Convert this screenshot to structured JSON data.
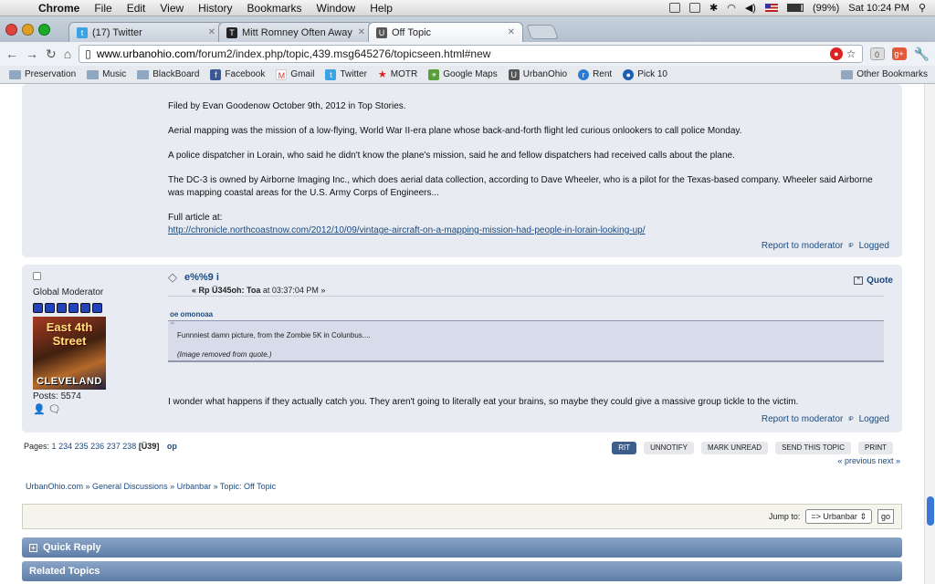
{
  "menubar": {
    "app": "Chrome",
    "items": [
      "File",
      "Edit",
      "View",
      "History",
      "Bookmarks",
      "Window",
      "Help"
    ],
    "battery": "(99%)",
    "clock": "Sat 10:24 PM"
  },
  "tabs": [
    {
      "title": "(17) Twitter",
      "active": false
    },
    {
      "title": "Mitt Romney Often Away Wh",
      "active": false
    },
    {
      "title": "Off Topic",
      "active": true
    }
  ],
  "toolbar": {
    "url_host": "www.urbanohio.com",
    "url_path": "/forum2/index.php/topic,439.msg645276/topicseen.html#new",
    "badge_count": "0"
  },
  "bookmarks": [
    "Preservation",
    "Music",
    "BlackBoard",
    "Facebook",
    "Gmail",
    "Twitter",
    "MOTR",
    "Google Maps",
    "UrbanOhio",
    "Rent",
    "Pick 10"
  ],
  "bookmarks_other": "Other Bookmarks",
  "post1": {
    "paragraphs": [
      "Filed by Evan Goodenow October 9th, 2012 in Top Stories.",
      "Aerial mapping was the mission of a low-flying, World War II-era plane whose back-and-forth flight led curious onlookers to call police Monday.",
      "A police dispatcher in Lorain, who said he didn't know the plane's mission, said he and fellow dispatchers had received calls about the plane.",
      "The DC-3 is owned by Airborne Imaging Inc., which does aerial data collection, according to Dave Wheeler, who is a pilot for the Texas-based company. Wheeler said Airborne was mapping coastal areas for the U.S. Army Corps of Engineers..."
    ],
    "full_article_label": "Full article at:",
    "link": "http://chronicle.northcoastnow.com/2012/10/09/vintage-aircraft-on-a-mapping-mission-had-people-in-lorain-looking-up/",
    "report": "Report to moderator",
    "logged": "Logged"
  },
  "post2": {
    "role": "Global Moderator",
    "avatar_top": "East 4th Street",
    "avatar_bottom": "CLEVELAND",
    "posts": "Posts: 5574",
    "subject": "e%%9 i",
    "subhead_pre": "« Rp Ü345oh: Toa",
    "subhead_post": "at 03:37:04 PM »",
    "quote_label": "Quote",
    "quote_header": "oe omonoaa",
    "quote_line1": "Funnniest damn picture, from the Zombie 5K in Colunbus....",
    "quote_line2": "(Image removed from quote.)",
    "message": "I wonder what happens if they actually catch you.  They aren't going to literally eat your brains, so maybe they could give a massive group tickle to the victim.",
    "report": "Report to moderator",
    "logged": "Logged"
  },
  "pagination": {
    "label": "Pages:",
    "first": "1",
    "pages": [
      "234",
      "235",
      "236",
      "237",
      "238"
    ],
    "current": "[Ü39]",
    "top": "op"
  },
  "buttons": [
    "RIT",
    "UNNOTIFY",
    "MARK UNREAD",
    "SEND THIS TOPIC",
    "PRINT"
  ],
  "prevnext": "« previous next »",
  "breadcrumb": "UrbanOhio.com » General Discussions » Urbanbar » Topic: Off Topic",
  "jump": {
    "label": "Jump to:",
    "value": "=> Urbanbar",
    "go": "go"
  },
  "sections": {
    "quick_reply": "Quick Reply",
    "related": "Related Topics"
  },
  "colors": {
    "accent": "#1a4a80",
    "post_bg": "#e8ecf2",
    "header_bar": "#5e7ea8"
  }
}
